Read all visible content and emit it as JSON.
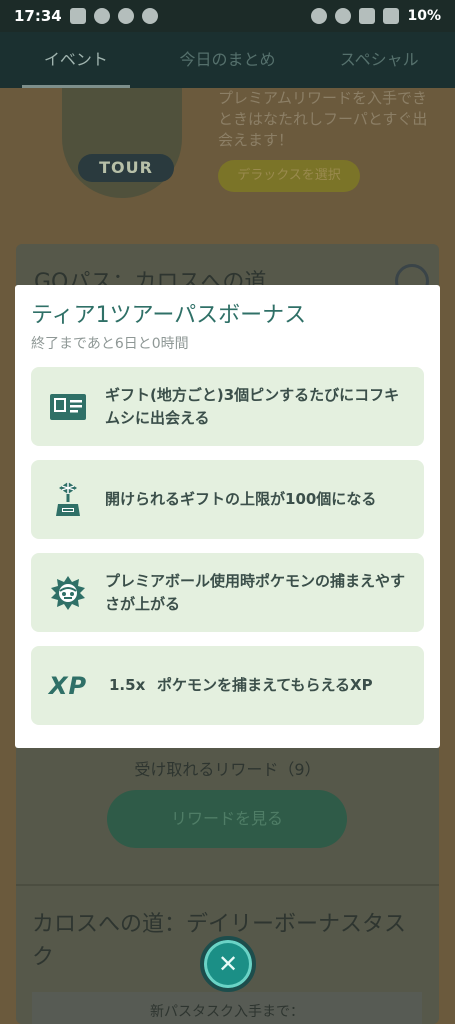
{
  "status_bar": {
    "time": "17:34",
    "battery": "10%"
  },
  "tabs": [
    {
      "label": "イベント",
      "active": true
    },
    {
      "label": "今日のまとめ",
      "active": false
    },
    {
      "label": "スペシャル",
      "active": false
    }
  ],
  "background": {
    "tour_badge": "TOUR",
    "promo_text": "プレミアムリワードを入手できときはなたれしフーパとすぐ出会えます！",
    "deluxe_button": "デラックスを選択",
    "go_pass_title": "GOパス：カロスへの道",
    "rewards_count": "受け取れるリワード（9）",
    "view_rewards_button": "リワードを見る",
    "daily_title": "カロスへの道：デイリーボーナスタスク",
    "task_bar": "新パスタスク入手まで："
  },
  "modal": {
    "title": "ティア1ツアーパスボーナス",
    "subtitle": "終了まであと6日と0時間",
    "bonuses": [
      {
        "icon": "postcard-icon",
        "text": "ギフト(地方ごと)3個ピンするたびにコフキムシに出会える"
      },
      {
        "icon": "gift-box-icon",
        "text": "開けられるギフトの上限が100個になる"
      },
      {
        "icon": "premier-ball-pokemon-icon",
        "text": "プレミアボール使用時ポケモンの捕まえやすさが上がる"
      }
    ],
    "xp_bonus": {
      "label": "XP",
      "multiplier": "1.5x",
      "text": "ポケモンを捕まえてもらえるXP"
    }
  },
  "colors": {
    "accent": "#2f7067",
    "card_bg": "#e4f0df",
    "close_button": "#1b8f86"
  }
}
